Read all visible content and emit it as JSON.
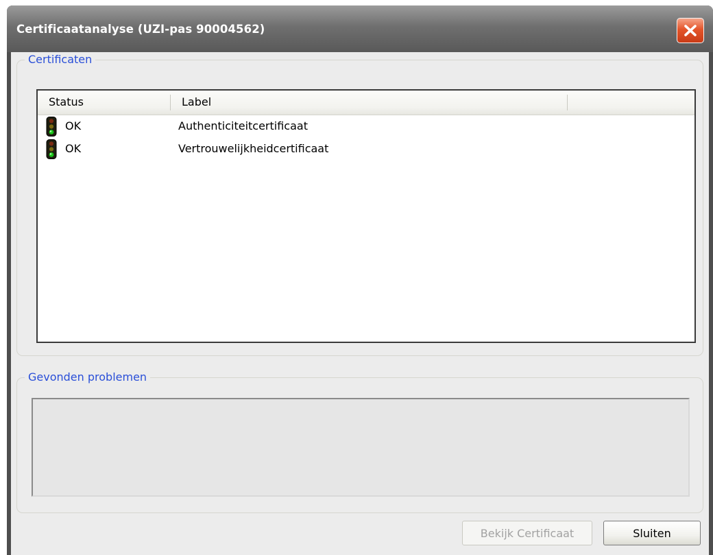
{
  "window": {
    "title": "Certificaatanalyse (UZI-pas 90004562)",
    "close_icon": "close-icon"
  },
  "certificates_group": {
    "label": "Certificaten",
    "columns": [
      "Status",
      "Label"
    ],
    "rows": [
      {
        "status": "OK",
        "label": "Authenticiteitcertificaat",
        "icon": "traffic-light-green-icon"
      },
      {
        "status": "OK",
        "label": "Vertrouwelijkheidcertificaat",
        "icon": "traffic-light-green-icon"
      }
    ]
  },
  "problems_group": {
    "label": "Gevonden problemen",
    "text": ""
  },
  "buttons": {
    "view_certificate": "Bekijk Certificaat",
    "close": "Sluiten"
  },
  "colors": {
    "group_label": "#2a4fd8",
    "close_button": "#e4552a",
    "status_ok_light": "#19c419"
  }
}
